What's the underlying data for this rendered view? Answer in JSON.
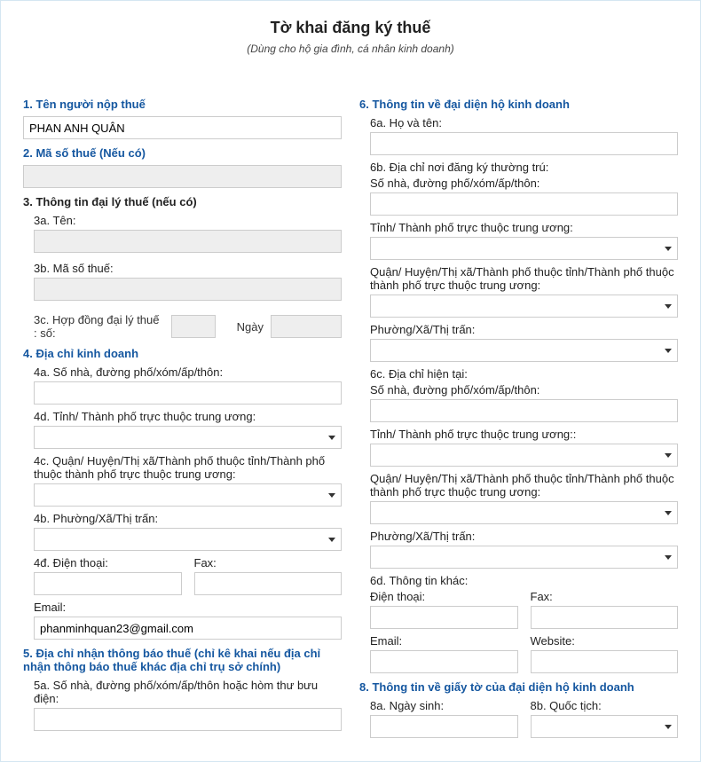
{
  "header": {
    "title": "Tờ khai đăng ký thuế",
    "subtitle": "(Dùng cho hộ gia đình, cá nhân kinh doanh)"
  },
  "left": {
    "s1": {
      "heading": "1. Tên người nộp thuế",
      "value": "PHAN ANH QUÂN"
    },
    "s2": {
      "heading": "2. Mã số thuế (Nếu có)",
      "value": ""
    },
    "s3": {
      "heading": "3. Thông tin đại lý thuế (nếu có)",
      "a_label": "3a. Tên:",
      "a_value": "",
      "b_label": "3b. Mã số thuế:",
      "b_value": "",
      "c_label_pre": "3c. Hợp đồng đại lý thuế : số:",
      "c_num": "",
      "c_date_label": "Ngày",
      "c_date": ""
    },
    "s4": {
      "heading": "4. Địa chỉ kinh doanh",
      "a_label": "4a. Số nhà, đường phố/xóm/ấp/thôn:",
      "a_value": "",
      "d_label": "4d. Tỉnh/ Thành phố trực thuộc trung ương:",
      "c_label": "4c. Quận/ Huyện/Thị xã/Thành phố thuộc tỉnh/Thành phố thuộc thành phố trực thuộc trung ương:",
      "b_label": "4b. Phường/Xã/Thị trấn:",
      "dd_label": "4đ. Điện thoại:",
      "dd_value": "",
      "fax_label": "Fax:",
      "fax_value": "",
      "email_label": "Email:",
      "email_value": "phanminhquan23@gmail.com"
    },
    "s5": {
      "heading": "5. Địa chỉ nhận thông báo thuế (chỉ kê khai nếu địa chỉ nhận thông báo thuế khác địa chỉ trụ sở chính)",
      "a_label": "5a. Số nhà, đường phố/xóm/ấp/thôn hoặc hòm thư bưu điện:",
      "a_value": ""
    }
  },
  "right": {
    "s6": {
      "heading": "6. Thông tin về đại diện hộ kinh doanh",
      "a_label": "6a. Họ và tên:",
      "a_value": "",
      "b_label": "6b. Địa chỉ nơi đăng ký thường trú:",
      "b_addr_label": "Số nhà, đường phố/xóm/ấp/thôn:",
      "b_addr_value": "",
      "b_prov_label": "Tỉnh/ Thành phố trực thuộc trung ương:",
      "b_dist_label": "Quận/ Huyện/Thị xã/Thành phố thuộc tỉnh/Thành phố thuộc thành phố trực thuộc trung ương:",
      "b_ward_label": "Phường/Xã/Thị trấn:",
      "c_label": "6c. Địa chỉ hiện tại:",
      "c_addr_label": "Số nhà, đường phố/xóm/ấp/thôn:",
      "c_addr_value": "",
      "c_prov_label": "Tỉnh/ Thành phố trực thuộc trung ương::",
      "c_dist_label": "Quận/ Huyện/Thị xã/Thành phố thuộc tỉnh/Thành phố thuộc thành phố trực thuộc trung ương:",
      "c_ward_label": "Phường/Xã/Thị trấn:",
      "d_label": "6d. Thông tin khác:",
      "d_phone_label": "Điện thoại:",
      "d_phone_value": "",
      "d_fax_label": "Fax:",
      "d_fax_value": "",
      "d_email_label": "Email:",
      "d_email_value": "",
      "d_web_label": "Website:",
      "d_web_value": ""
    },
    "s8": {
      "heading": "8. Thông tin về giấy tờ của đại diện hộ kinh doanh",
      "a_label": "8a. Ngày sinh:",
      "a_value": "",
      "b_label": "8b. Quốc tịch:"
    }
  }
}
